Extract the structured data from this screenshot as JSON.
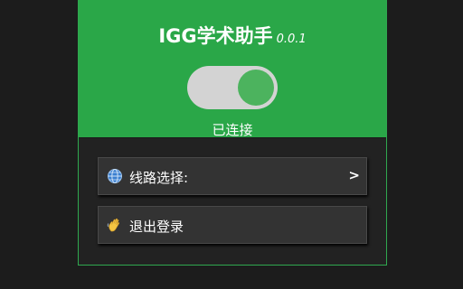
{
  "header": {
    "title": "IGG学术助手",
    "version": "0.0.1"
  },
  "connection": {
    "enabled": true,
    "status_text": "已连接"
  },
  "menu": {
    "line_select": {
      "label": "线路选择:",
      "icon": "globe-icon",
      "arrow": ">"
    },
    "logout": {
      "label": "退出登录",
      "icon": "waving-hand-icon"
    }
  },
  "colors": {
    "accent_green": "#2aa748",
    "toggle_track": "#d3d3d3",
    "toggle_knob": "#4cb35e",
    "page_bg": "#1c1c1c",
    "button_bg": "#333333"
  }
}
